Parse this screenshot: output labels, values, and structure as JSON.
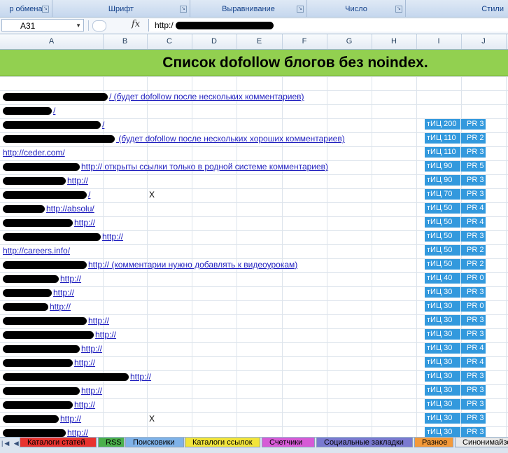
{
  "ribbon": {
    "groups": [
      {
        "label": "р обмена"
      },
      {
        "label": "Шрифт"
      },
      {
        "label": "Выравнивание"
      },
      {
        "label": "Число"
      },
      {
        "label": "Стили"
      }
    ]
  },
  "formula_bar": {
    "name_box": "A31",
    "fx_label": "fx",
    "content": "http:/"
  },
  "columns": [
    "A",
    "B",
    "C",
    "D",
    "E",
    "F",
    "G",
    "H",
    "I",
    "J"
  ],
  "banner_title": "Список dofollow блогов без noindex.",
  "rows": [
    {
      "url": "/",
      "note": "(будет dofollow после нескольких комментариев)",
      "x": "",
      "tic": "",
      "pr": ""
    },
    {
      "url": "/",
      "note": "",
      "x": "",
      "tic": "",
      "pr": ""
    },
    {
      "url": "/",
      "note": "",
      "x": "",
      "tic": "тИЦ 200",
      "pr": "PR 3"
    },
    {
      "url": "",
      "note": "(будет dofollow после нескольких хороших комментариев)",
      "x": "",
      "tic": "тИЦ 110",
      "pr": "PR 2"
    },
    {
      "url": "http://ceder.com/",
      "note": "",
      "x": "",
      "tic": "тИЦ 110",
      "pr": "PR 3"
    },
    {
      "url": "http://",
      "note": "открыты ссылки только в родной системе комментариев)",
      "x": "",
      "tic": "тИЦ 90",
      "pr": "PR 5"
    },
    {
      "url": "http://",
      "note": "",
      "x": "",
      "tic": "тИЦ 90",
      "pr": "PR 3"
    },
    {
      "url": "/",
      "note": "",
      "x": "X",
      "tic": "тИЦ 70",
      "pr": "PR 3"
    },
    {
      "url": "http://absolu/",
      "note": "",
      "x": "",
      "tic": "тИЦ 50",
      "pr": "PR 4"
    },
    {
      "url": "http://",
      "note": "",
      "x": "",
      "tic": "тИЦ 50",
      "pr": "PR 4"
    },
    {
      "url": "http://",
      "note": "",
      "x": "",
      "tic": "тИЦ 50",
      "pr": "PR 3"
    },
    {
      "url": "http://careers.info/",
      "note": "",
      "x": "",
      "tic": "тИЦ 50",
      "pr": "PR 2"
    },
    {
      "url": "http://",
      "note": "(комментарии нужно добавлять к видеоурокам)",
      "x": "",
      "tic": "тИЦ 50",
      "pr": "PR 2"
    },
    {
      "url": "http://",
      "note": "",
      "x": "",
      "tic": "тИЦ 40",
      "pr": "PR 0"
    },
    {
      "url": "http://",
      "note": "",
      "x": "",
      "tic": "тИЦ 30",
      "pr": "PR 3"
    },
    {
      "url": "http://",
      "note": "",
      "x": "",
      "tic": "тИЦ 30",
      "pr": "PR 0"
    },
    {
      "url": "http://",
      "note": "",
      "x": "",
      "tic": "тИЦ 30",
      "pr": "PR 3"
    },
    {
      "url": "http://",
      "note": "",
      "x": "",
      "tic": "тИЦ 30",
      "pr": "PR 3"
    },
    {
      "url": "http://",
      "note": "",
      "x": "",
      "tic": "тИЦ 30",
      "pr": "PR 4"
    },
    {
      "url": "http://",
      "note": "",
      "x": "",
      "tic": "тИЦ 30",
      "pr": "PR 4"
    },
    {
      "url": "http://",
      "note": "",
      "x": "",
      "tic": "тИЦ 30",
      "pr": "PR 3"
    },
    {
      "url": "http://",
      "note": "",
      "x": "",
      "tic": "тИЦ 30",
      "pr": "PR 3"
    },
    {
      "url": "http://",
      "note": "",
      "x": "",
      "tic": "тИЦ 30",
      "pr": "PR 3"
    },
    {
      "url": "http://",
      "note": "",
      "x": "X",
      "tic": "тИЦ 30",
      "pr": "PR 3"
    },
    {
      "url": "http://",
      "note": "",
      "x": "",
      "tic": "тИЦ 30",
      "pr": "PR 3"
    }
  ],
  "sheet_tabs": [
    {
      "label": "Каталоги статей",
      "color": "#e8322e"
    },
    {
      "label": "RSS",
      "color": "#4bb04b"
    },
    {
      "label": "Поисковики",
      "color": "#7fb2e8"
    },
    {
      "label": "Каталоги ссылок",
      "color": "#f2e43a"
    },
    {
      "label": "Счетчики",
      "color": "#d65bd6"
    },
    {
      "label": "Социальные закладки",
      "color": "#7a7ad0"
    },
    {
      "label": "Разное",
      "color": "#f49a3a"
    },
    {
      "label": "Синонимайзер",
      "color": "#e8e8e8"
    }
  ],
  "nav_arrows": "|◀ ◀ ▶ ▶|"
}
